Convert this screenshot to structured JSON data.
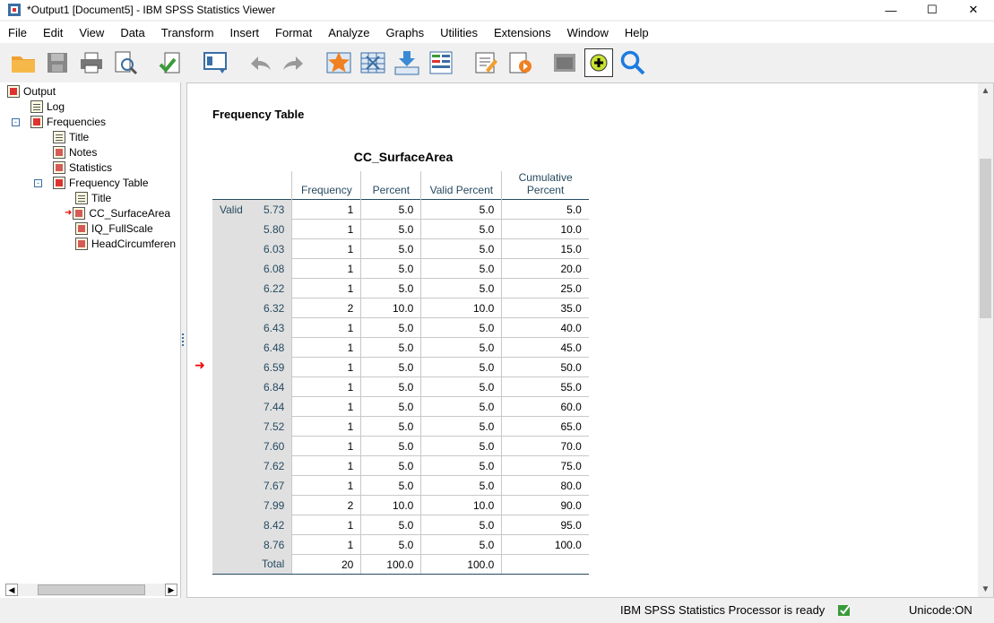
{
  "window": {
    "title": "*Output1 [Document5] - IBM SPSS Statistics Viewer"
  },
  "menu": [
    "File",
    "Edit",
    "View",
    "Data",
    "Transform",
    "Insert",
    "Format",
    "Analyze",
    "Graphs",
    "Utilities",
    "Extensions",
    "Window",
    "Help"
  ],
  "toolbar_icons": [
    "open-folder-icon",
    "save-icon",
    "print-icon",
    "print-preview-icon",
    "export-icon",
    "goto-data-icon",
    "undo-icon",
    "redo-icon",
    "goto-case-icon",
    "goto-variable-icon",
    "insert-cases-icon",
    "insert-variable-icon",
    "edit-icon",
    "run-script-icon",
    "designate-window-icon",
    "add-icon",
    "search-icon"
  ],
  "outline": {
    "items": [
      "Output",
      "Log",
      "Frequencies",
      "Title",
      "Notes",
      "Statistics",
      "Frequency Table",
      "Title",
      "CC_SurfaceArea",
      "IQ_FullScale",
      "HeadCircumferen"
    ]
  },
  "content": {
    "heading": "Frequency Table",
    "table_title": "CC_SurfaceArea",
    "columns": [
      "Frequency",
      "Percent",
      "Valid Percent",
      "Cumulative Percent"
    ],
    "group_label": "Valid",
    "rows": [
      [
        "5.73",
        "1",
        "5.0",
        "5.0",
        "5.0"
      ],
      [
        "5.80",
        "1",
        "5.0",
        "5.0",
        "10.0"
      ],
      [
        "6.03",
        "1",
        "5.0",
        "5.0",
        "15.0"
      ],
      [
        "6.08",
        "1",
        "5.0",
        "5.0",
        "20.0"
      ],
      [
        "6.22",
        "1",
        "5.0",
        "5.0",
        "25.0"
      ],
      [
        "6.32",
        "2",
        "10.0",
        "10.0",
        "35.0"
      ],
      [
        "6.43",
        "1",
        "5.0",
        "5.0",
        "40.0"
      ],
      [
        "6.48",
        "1",
        "5.0",
        "5.0",
        "45.0"
      ],
      [
        "6.59",
        "1",
        "5.0",
        "5.0",
        "50.0"
      ],
      [
        "6.84",
        "1",
        "5.0",
        "5.0",
        "55.0"
      ],
      [
        "7.44",
        "1",
        "5.0",
        "5.0",
        "60.0"
      ],
      [
        "7.52",
        "1",
        "5.0",
        "5.0",
        "65.0"
      ],
      [
        "7.60",
        "1",
        "5.0",
        "5.0",
        "70.0"
      ],
      [
        "7.62",
        "1",
        "5.0",
        "5.0",
        "75.0"
      ],
      [
        "7.67",
        "1",
        "5.0",
        "5.0",
        "80.0"
      ],
      [
        "7.99",
        "2",
        "10.0",
        "10.0",
        "90.0"
      ],
      [
        "8.42",
        "1",
        "5.0",
        "5.0",
        "95.0"
      ],
      [
        "8.76",
        "1",
        "5.0",
        "5.0",
        "100.0"
      ],
      [
        "Total",
        "20",
        "100.0",
        "100.0",
        ""
      ]
    ]
  },
  "status": {
    "text": "IBM SPSS Statistics Processor is ready",
    "unicode": "Unicode:ON"
  },
  "colors": {
    "header_text": "#264a60",
    "row_header_bg": "#e0e0e0",
    "accent": "#3a6ea5"
  }
}
